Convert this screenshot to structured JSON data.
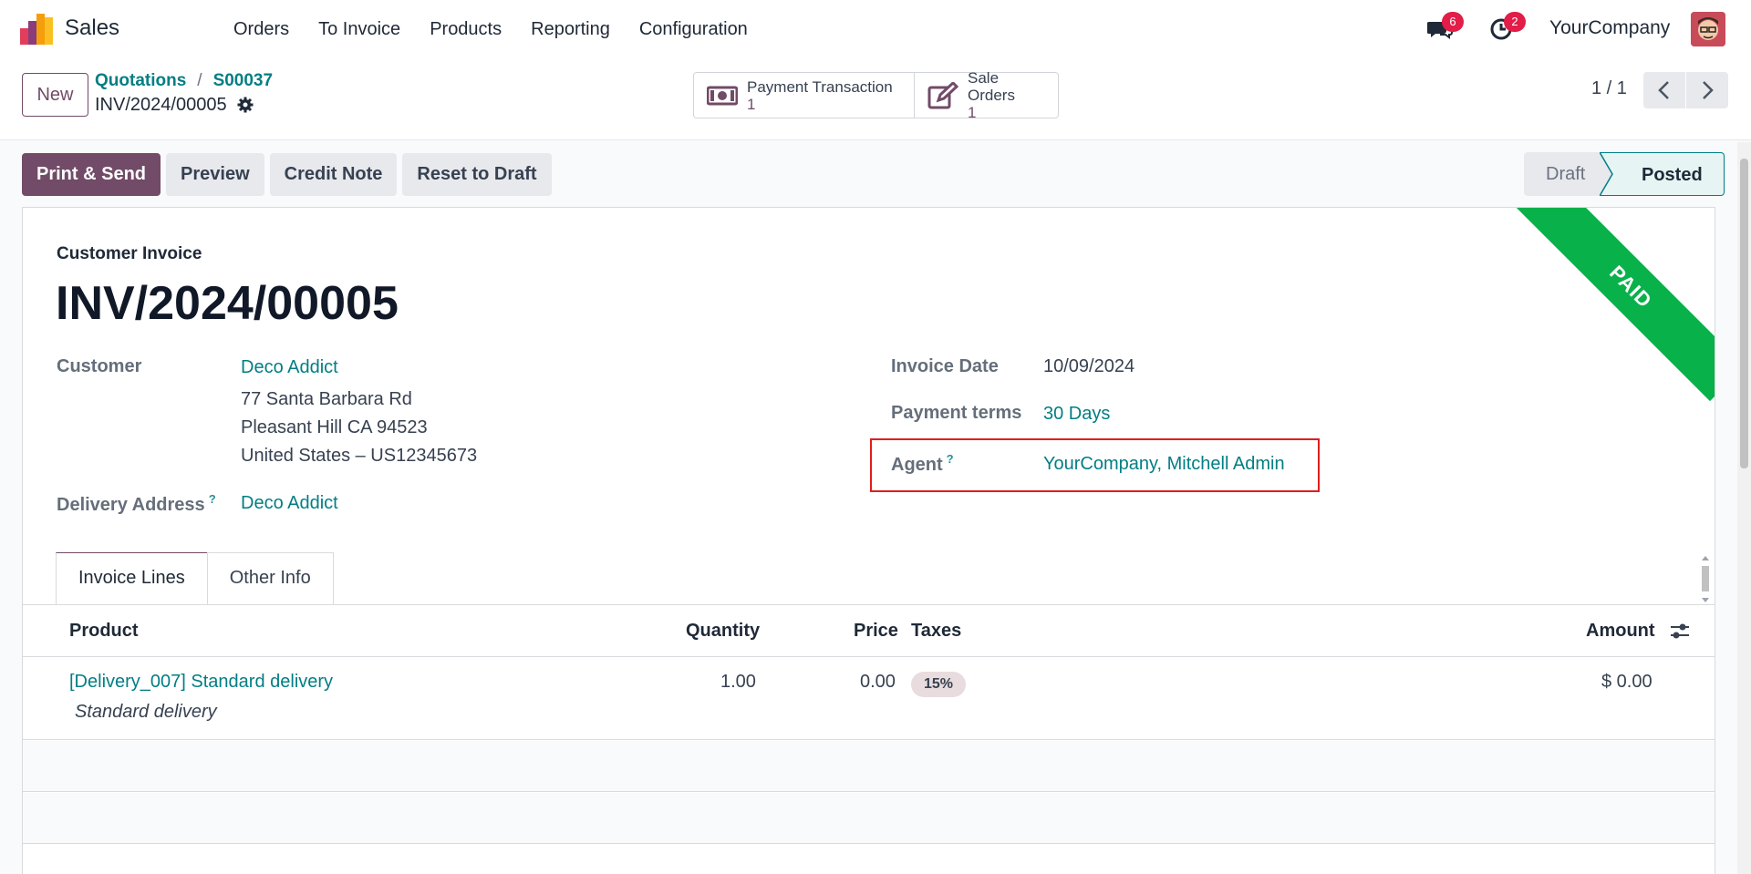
{
  "navbar": {
    "app_name": "Sales",
    "menu": [
      "Orders",
      "To Invoice",
      "Products",
      "Reporting",
      "Configuration"
    ],
    "messages_badge": "6",
    "activities_badge": "2",
    "company": "YourCompany"
  },
  "control_panel": {
    "new_label": "New",
    "breadcrumb": [
      "Quotations",
      "S00037"
    ],
    "breadcrumb_sep": "/",
    "record_name": "INV/2024/00005",
    "smart_buttons": [
      {
        "label": "Payment Transaction",
        "value": "1",
        "icon": "money-icon"
      },
      {
        "label": "Sale Orders",
        "value": "1",
        "icon": "edit-icon"
      }
    ],
    "pager": "1 / 1"
  },
  "actions": [
    "Print & Send",
    "Preview",
    "Credit Note",
    "Reset to Draft"
  ],
  "statusbar": {
    "stages": [
      "Draft",
      "Posted"
    ],
    "current": "Posted"
  },
  "invoice": {
    "ribbon": "PAID",
    "type": "Customer Invoice",
    "name": "INV/2024/00005",
    "customer_label": "Customer",
    "customer": "Deco Addict",
    "address_lines": [
      "77 Santa Barbara Rd",
      "Pleasant Hill CA 94523",
      "United States – US12345673"
    ],
    "delivery_label": "Delivery Address",
    "delivery": "Deco Addict",
    "date_label": "Invoice Date",
    "date": "10/09/2024",
    "terms_label": "Payment terms",
    "terms": "30 Days",
    "agent_label": "Agent",
    "agent": "YourCompany, Mitchell Admin",
    "help_mark": "?"
  },
  "tabs": [
    "Invoice Lines",
    "Other Info"
  ],
  "lines": {
    "headers": {
      "product": "Product",
      "quantity": "Quantity",
      "price": "Price",
      "taxes": "Taxes",
      "amount": "Amount"
    },
    "rows": [
      {
        "product": "[Delivery_007] Standard delivery",
        "description": "Standard delivery",
        "quantity": "1.00",
        "price": "0.00",
        "tax": "15%",
        "amount": "$ 0.00"
      }
    ]
  },
  "colors": {
    "brand": "#714b67",
    "link": "#017e84",
    "paid_ribbon": "#09b14a",
    "highlight": "#e11d1d"
  }
}
